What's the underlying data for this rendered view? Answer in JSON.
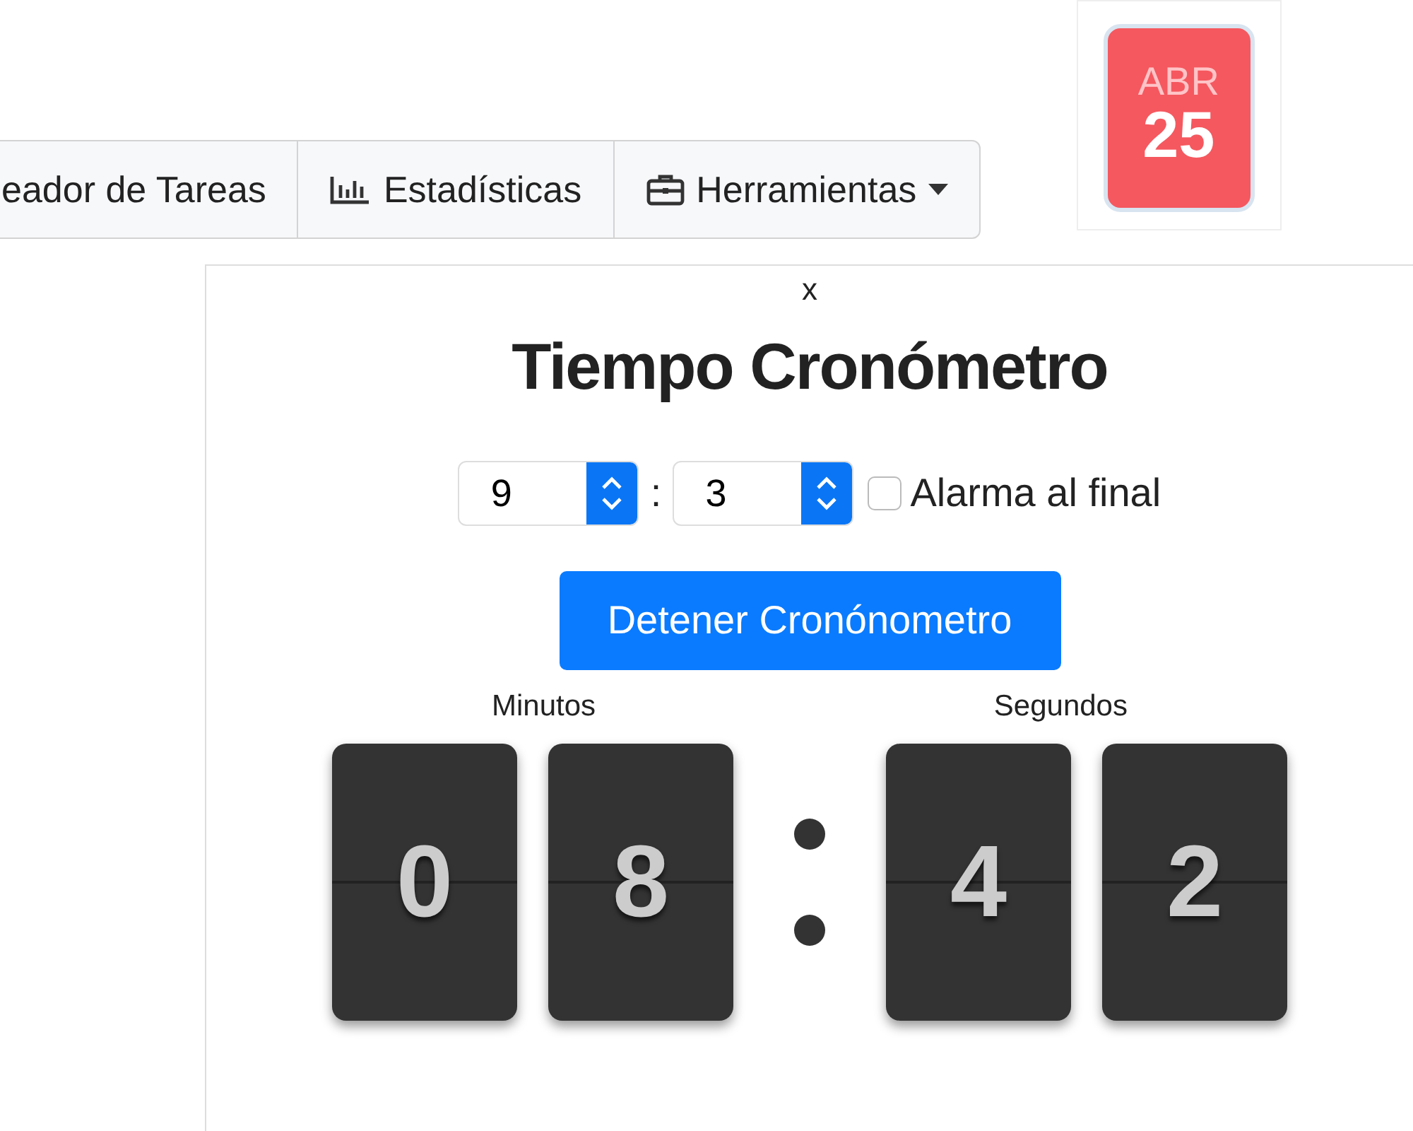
{
  "nav": {
    "items": [
      {
        "label": "eador de Tareas",
        "kind": "plain",
        "dropdown": false
      },
      {
        "label": "Estadísticas",
        "kind": "chart",
        "dropdown": false
      },
      {
        "label": "Herramientas",
        "kind": "briefcase",
        "dropdown": true
      }
    ]
  },
  "calendar": {
    "month": "ABR",
    "day": "25"
  },
  "panel": {
    "close": "x",
    "title": "Tiempo Cronómetro",
    "minutes_select": {
      "value": "9"
    },
    "separator": ":",
    "seconds_select": {
      "value": "3"
    },
    "alarm": {
      "label": "Alarma al final",
      "checked": false
    },
    "button": "Detener Cronónometro",
    "minutes_label": "Minutos",
    "seconds_label": "Segundos",
    "minutes_digits": [
      "0",
      "8"
    ],
    "seconds_digits": [
      "4",
      "2"
    ]
  }
}
